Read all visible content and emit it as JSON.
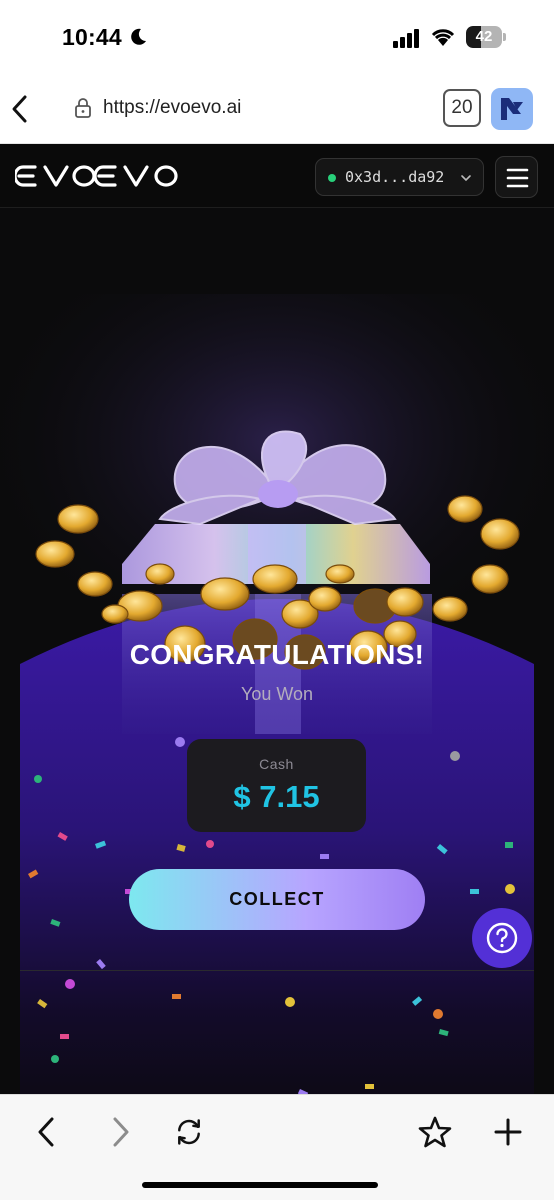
{
  "status_bar": {
    "time": "10:44",
    "battery_level": "42",
    "icons": [
      "moon-icon",
      "signal-icon",
      "wifi-icon",
      "battery-icon"
    ]
  },
  "browser": {
    "url": "https://evoevo.ai",
    "tab_count": "20",
    "icons": [
      "back-icon",
      "lock-icon",
      "extension-icon"
    ]
  },
  "app_header": {
    "logo_text": "EVOEVO",
    "wallet_address": "0x3d...da92",
    "wallet_status_color": "#28d07a",
    "icons": [
      "chevron-down-icon",
      "menu-icon"
    ]
  },
  "reward": {
    "title": "CONGRATULATIONS!",
    "subtitle": "You Won",
    "prize_label": "Cash",
    "prize_value": "$ 7.15",
    "prize_color": "#20c4e4",
    "collect_label": "COLLECT",
    "help_icon": "question-icon"
  },
  "toolbar": {
    "icons": [
      "back-icon",
      "forward-icon",
      "reload-icon",
      "star-icon",
      "plus-icon"
    ]
  },
  "colors": {
    "app_background": "#0b0b0c",
    "modal_purple": "#3a1c9c",
    "help_button": "#5330d6"
  }
}
